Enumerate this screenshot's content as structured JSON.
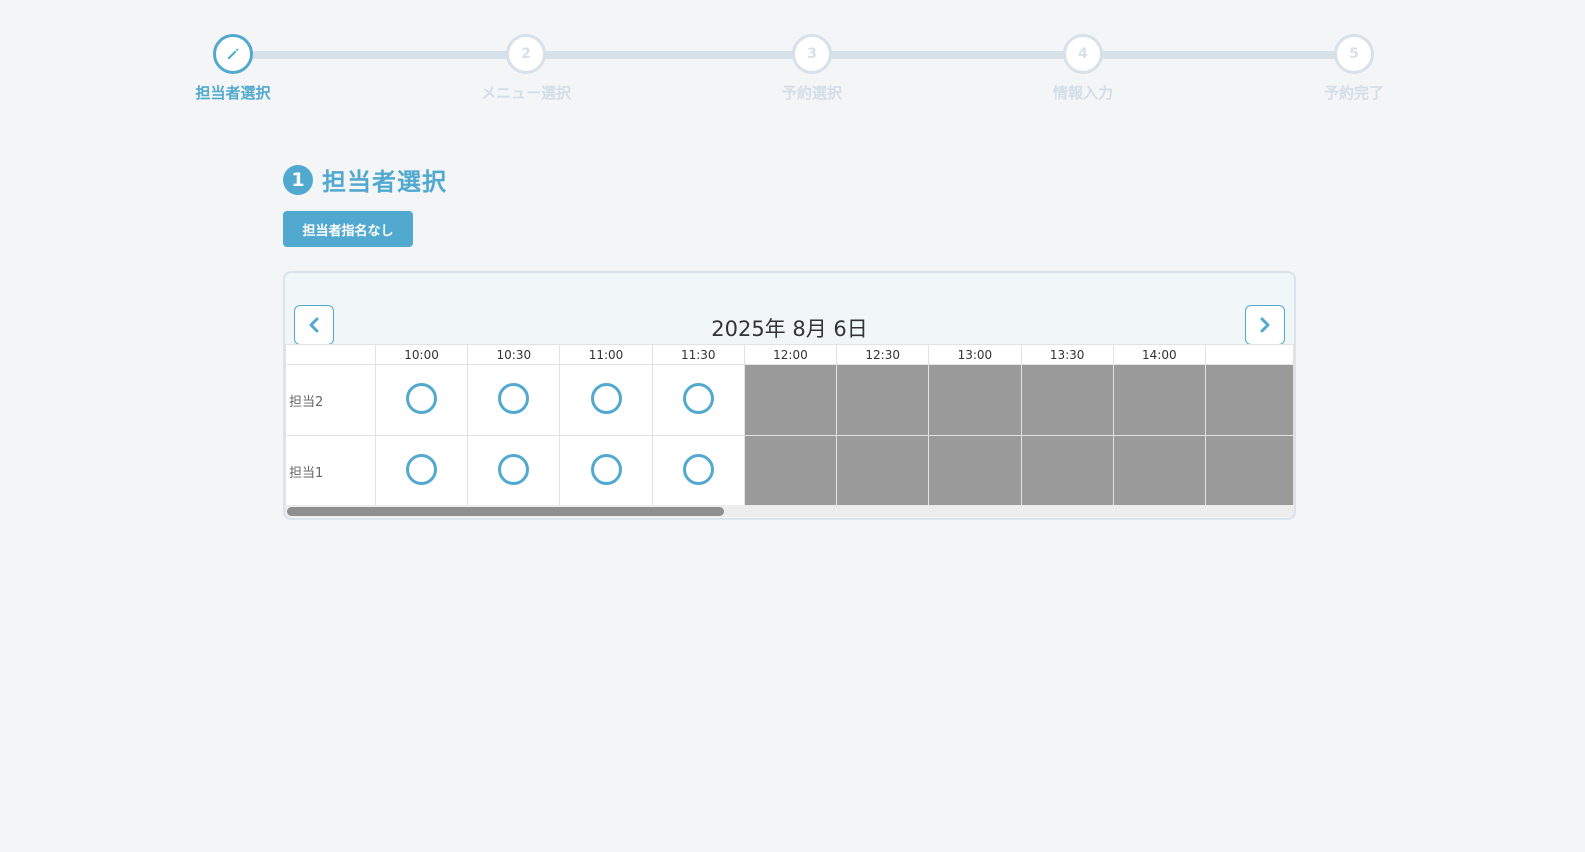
{
  "stepper": {
    "steps": [
      {
        "number": "",
        "label": "担当者選択",
        "icon": "pencil-icon",
        "active": true
      },
      {
        "number": "2",
        "label": "メニュー選択",
        "active": false
      },
      {
        "number": "3",
        "label": "予約選択",
        "active": false
      },
      {
        "number": "4",
        "label": "情報入力",
        "active": false
      },
      {
        "number": "5",
        "label": "予約完了",
        "active": false
      }
    ]
  },
  "section": {
    "number": "1",
    "title": "担当者選択",
    "no_staff_button": "担当者指名なし"
  },
  "calendar": {
    "date": "2025年 8月 6日",
    "prev_icon": "chevron-left-icon",
    "next_icon": "chevron-right-icon",
    "time_slots": [
      "10:00",
      "10:30",
      "11:00",
      "11:30",
      "12:00",
      "12:30",
      "13:00",
      "13:30",
      "14:00"
    ],
    "rows": [
      {
        "staff": "担当2",
        "slots": [
          "open",
          "open",
          "open",
          "open",
          "closed",
          "closed",
          "closed",
          "closed",
          "closed",
          "closed"
        ]
      },
      {
        "staff": "担当1",
        "slots": [
          "open",
          "open",
          "open",
          "open",
          "closed",
          "closed",
          "closed",
          "closed",
          "closed",
          "closed"
        ]
      }
    ],
    "available_mark": "circle-available-icon"
  },
  "colors": {
    "accent": "#52a9cf",
    "inactive": "#d6e1ea",
    "closed_slot": "#9a9a9a",
    "background": "#f3f5f7"
  }
}
